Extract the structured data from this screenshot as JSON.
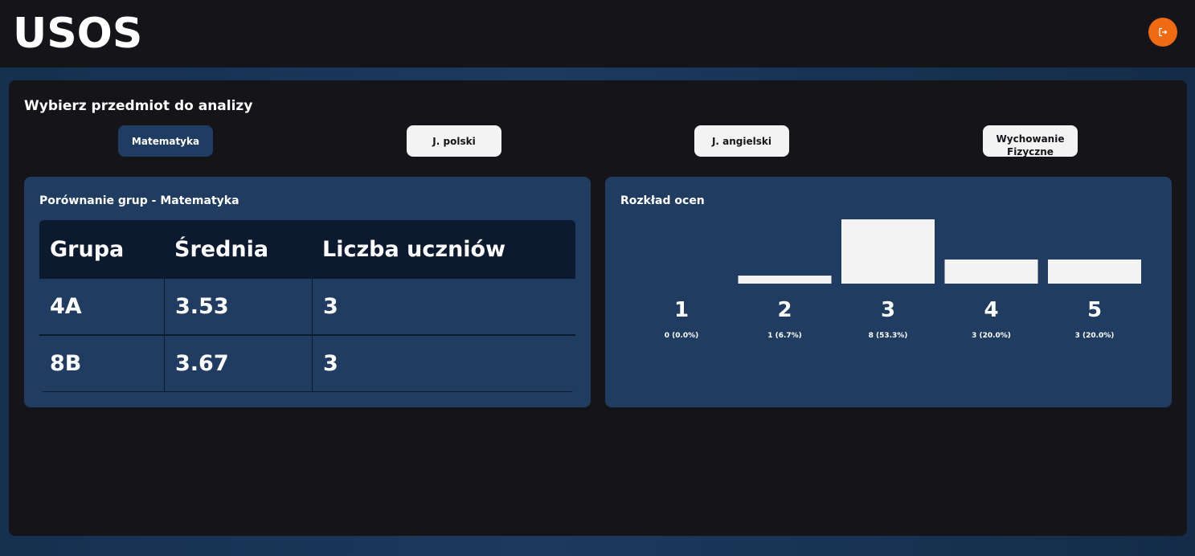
{
  "header": {
    "logo": "USOS",
    "logout_icon": "logout-icon",
    "accent": "#f06a12"
  },
  "subject_picker": {
    "title": "Wybierz przedmiot do analizy",
    "subjects": [
      {
        "label": "Matematyka",
        "active": true
      },
      {
        "label": "J. polski",
        "active": false
      },
      {
        "label": "J. angielski",
        "active": false
      },
      {
        "label": "Wychowanie Fizyczne",
        "active": false
      }
    ]
  },
  "comparison": {
    "title": "Porównanie grup - Matematyka",
    "columns": [
      "Grupa",
      "Średnia",
      "Liczba uczniów"
    ],
    "rows": [
      [
        "4A",
        "3.53",
        "3"
      ],
      [
        "8B",
        "3.67",
        "3"
      ]
    ]
  },
  "distribution": {
    "title": "Rozkład ocen"
  },
  "chart_data": {
    "type": "bar",
    "title": "Rozkład ocen",
    "categories": [
      "1",
      "2",
      "3",
      "4",
      "5"
    ],
    "values": [
      0,
      1,
      8,
      3,
      3
    ],
    "value_labels": [
      "0 (0.0%)",
      "1 (6.7%)",
      "8 (53.3%)",
      "3 (20.0%)",
      "3 (20.0%)"
    ],
    "bar_color": "#f3f3f3",
    "grid": false
  }
}
